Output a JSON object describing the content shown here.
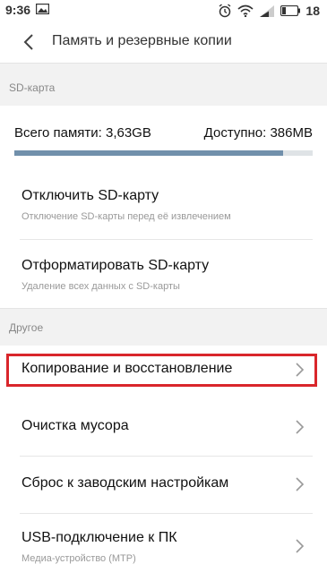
{
  "status_bar": {
    "time": "9:36",
    "battery_level": "18",
    "icons": [
      "gallery-icon",
      "alarm-icon",
      "wifi-icon",
      "signal-icon",
      "battery-icon"
    ]
  },
  "header": {
    "title": "Память и резервные копии",
    "back_icon": "chevron-left-icon"
  },
  "sd_section": {
    "label": "SD-карта",
    "total": "Всего памяти: 3,63GB",
    "free": "Доступно: 386MB",
    "used_fraction": 0.9,
    "bar_colors": {
      "used": "#7190ab",
      "free": "#dfe3e6"
    }
  },
  "sd_items": [
    {
      "title": "Отключить SD-карту",
      "subtitle": "Отключение SD-карты перед её извлечением"
    },
    {
      "title": "Отформатировать SD-карту",
      "subtitle": "Удаление всех данных с SD-карты"
    }
  ],
  "other_section": {
    "label": "Другое"
  },
  "other_items": [
    {
      "title": "Копирование и восстановление",
      "highlighted": true
    },
    {
      "title": "Очистка мусора"
    },
    {
      "title": "Сброс к заводским настройкам"
    },
    {
      "title": "USB-подключение к ПК",
      "subtitle": "Медиа-устройство (MTP)"
    }
  ],
  "colors": {
    "highlight_border": "#d9262b",
    "section_background": "#f2f2f2"
  }
}
